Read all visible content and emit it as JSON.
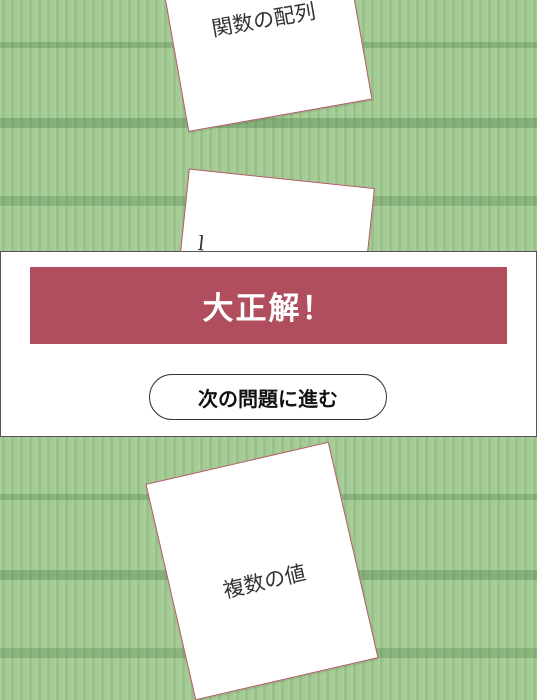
{
  "cards": [
    {
      "label": "関数の配列"
    },
    {
      "label": "l"
    },
    {
      "label": "複数の値"
    }
  ],
  "result": {
    "message": "大正解！",
    "next_button_label": "次の問題に進む"
  },
  "colors": {
    "background": "#9fc98f",
    "banner": "#b04e5e",
    "card_border": "#b05a62"
  }
}
